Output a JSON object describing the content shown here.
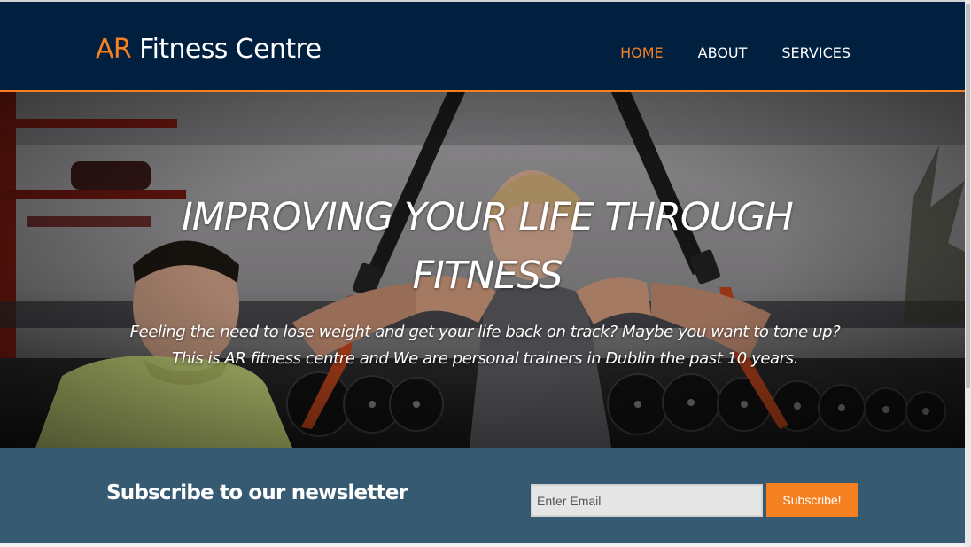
{
  "brand": {
    "accent": "AR",
    "name": " Fitness Centre"
  },
  "nav": {
    "items": [
      {
        "label": "HOME",
        "active": true
      },
      {
        "label": "ABOUT",
        "active": false
      },
      {
        "label": "SERVICES",
        "active": false
      }
    ]
  },
  "hero": {
    "title": "IMPROVING YOUR LIFE THROUGH FITNESS",
    "subtitle_line1": "Feeling the need to lose weight and get your life back on track? Maybe you want to tone up?",
    "subtitle_line2": "This is AR fitness centre and We are personal trainers in Dublin the past 10 years.",
    "image": "gym-trainer-photo"
  },
  "newsletter": {
    "heading": "Subscribe to our newsletter",
    "email_placeholder": "Enter Email",
    "email_value": "",
    "button_label": "Subscribe!"
  },
  "colors": {
    "header_bg": "#011f3f",
    "accent": "#f48021",
    "newsletter_bg": "#365a72",
    "text_light": "#ffffff"
  }
}
